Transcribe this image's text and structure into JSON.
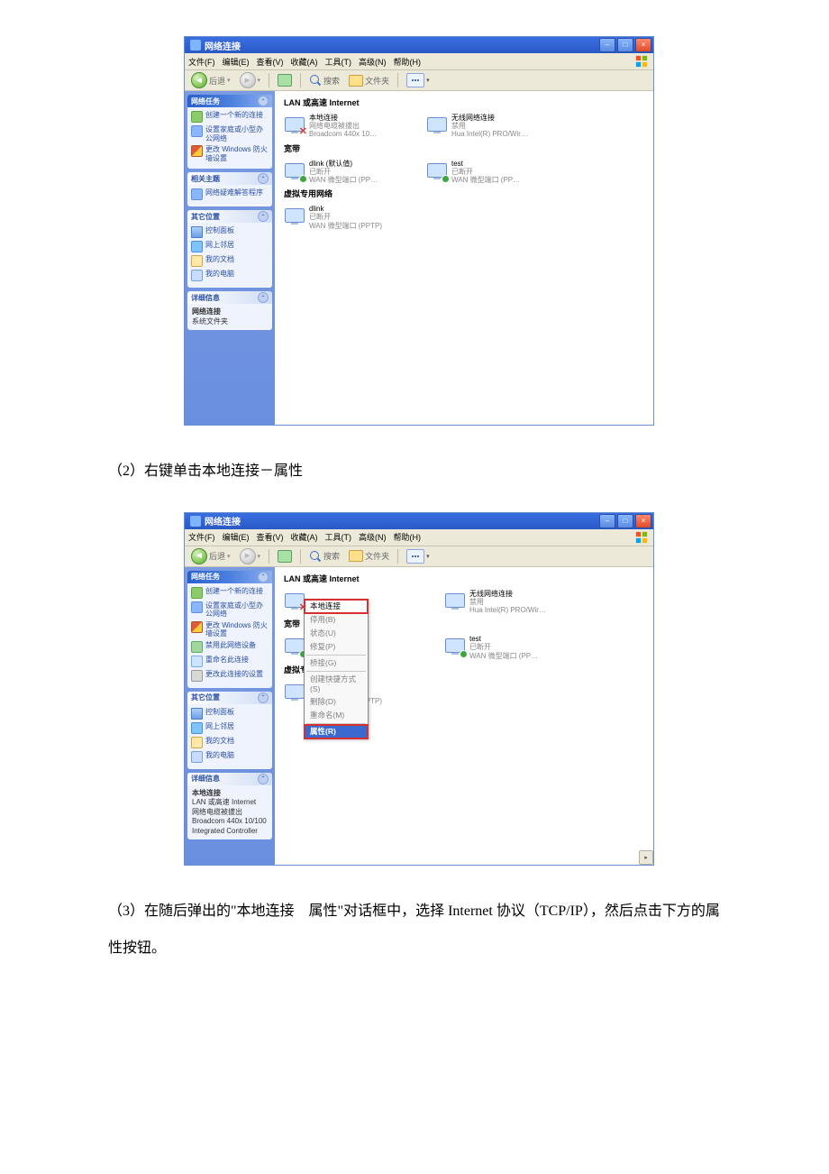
{
  "window": {
    "title": "网络连接",
    "win_controls": {
      "min": "–",
      "max": "□",
      "close": "×"
    }
  },
  "menubar": [
    "文件(F)",
    "编辑(E)",
    "查看(V)",
    "收藏(A)",
    "工具(T)",
    "高级(N)",
    "帮助(H)"
  ],
  "toolbar": {
    "back": "后退",
    "forward": "",
    "search": "搜索",
    "folders": "文件夹",
    "views_sep": "▾"
  },
  "sections": {
    "lan": "LAN 或高速 Internet",
    "dial": "宽带",
    "vpn": "虚拟专用网络"
  },
  "connections": {
    "local": {
      "l1": "本地连接",
      "l2": "网络电缆被拔出",
      "l3": "Broadcom 440x 10…"
    },
    "wlan": {
      "l1": "无线网络连接",
      "l2": "禁用",
      "l3": "Hua Intel(R) PRO/Wir…"
    },
    "dlink": {
      "l1": "dlink (默认值)",
      "l2": "已断开",
      "l3": "WAN 微型端口 (PP…"
    },
    "test": {
      "l1": "test",
      "l2": "已断开",
      "l3": "WAN 微型端口 (PP…"
    },
    "dlink2": {
      "l1": "dlink",
      "l2": "已断开",
      "l3": "WAN 微型端口 (PPTP)"
    }
  },
  "taskpane1": {
    "header_tasks": "网络任务",
    "t1": "创建一个新的连接",
    "t2": "设置家庭或小型办公网络",
    "t3": "更改 Windows 防火墙设置",
    "header_related": "相关主题",
    "r1": "网络疑难解答程序",
    "header_other": "其它位置",
    "o1": "控制面板",
    "o2": "网上邻居",
    "o3": "我的文档",
    "o4": "我的电脑",
    "header_detail": "详细信息",
    "d1": "网络连接",
    "d2": "系统文件夹"
  },
  "taskpane2": {
    "header_tasks": "网络任务",
    "t1": "创建一个新的连接",
    "t2": "设置家庭或小型办公网络",
    "t3": "更改 Windows 防火墙设置",
    "t4": "禁用此网络设备",
    "t5": "重命名此连接",
    "t6": "更改此连接的设置",
    "header_other": "其它位置",
    "o1": "控制面板",
    "o2": "网上邻居",
    "o3": "我的文档",
    "o4": "我的电脑",
    "header_detail": "详细信息",
    "d1": "本地连接",
    "d2": "LAN 或高速 Internet",
    "d3": "网络电缆被拔出",
    "d4": "Broadcom 440x 10/100",
    "d5": "Integrated Controller"
  },
  "ctxmenu": {
    "i0": "本地连接",
    "i1": "停用(B)",
    "i2": "状态(U)",
    "i3": "修复(P)",
    "i4": "桥接(G)",
    "i5": "创建快捷方式(S)",
    "i6": "删除(D)",
    "i7": "重命名(M)",
    "i8": "属性(R)"
  },
  "instructions": {
    "p2": "（2）右键单击本地连接－属性",
    "p3": "（3）在随后弹出的\"本地连接 属性\"对话框中，选择 Internet 协议（TCP/IP），然后点击下方的属性按钮。"
  }
}
